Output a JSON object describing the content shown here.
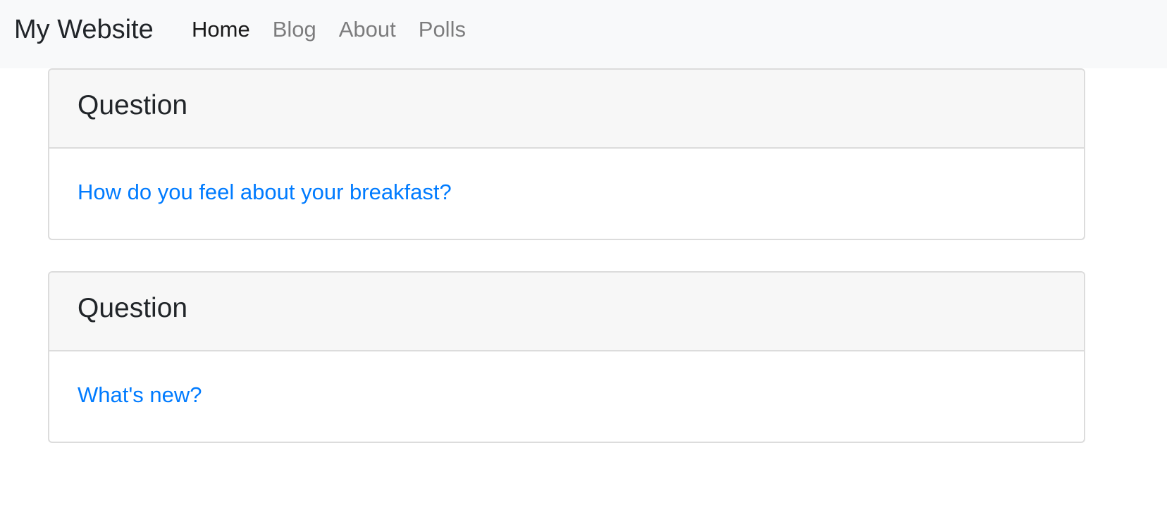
{
  "navbar": {
    "brand": "My Website",
    "items": [
      {
        "label": "Home",
        "active": true
      },
      {
        "label": "Blog",
        "active": false
      },
      {
        "label": "About",
        "active": false
      },
      {
        "label": "Polls",
        "active": false
      }
    ]
  },
  "questions": [
    {
      "header": "Question",
      "text": "How do you feel about your breakfast?"
    },
    {
      "header": "Question",
      "text": "What's new?"
    }
  ],
  "colors": {
    "navbar_bg": "#f8f9fa",
    "link": "#007bff",
    "card_header_bg": "#f7f7f7",
    "border": "#dcdcdc"
  }
}
